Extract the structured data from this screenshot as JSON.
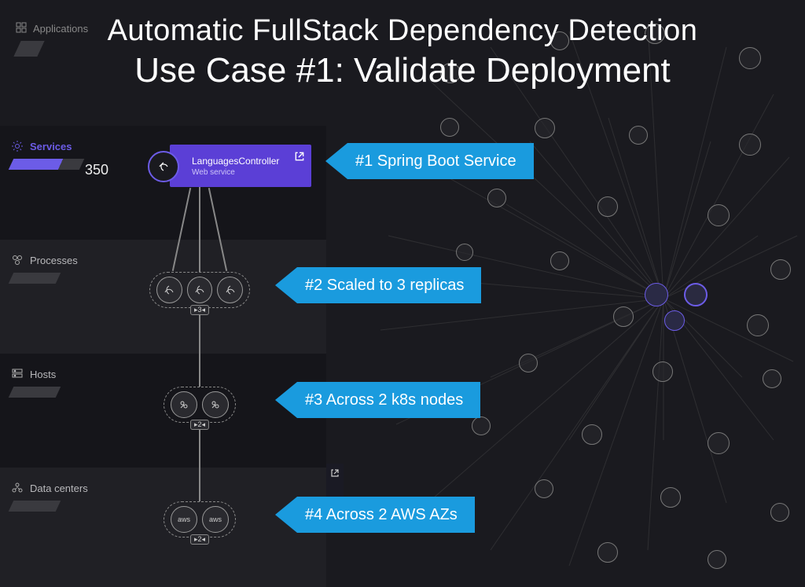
{
  "app_label": "Applications",
  "title": {
    "line1": "Automatic FullStack Dependency Detection",
    "line2": "Use Case #1: Validate Deployment"
  },
  "layers": {
    "services": {
      "label": "Services",
      "count": "350"
    },
    "processes": {
      "label": "Processes"
    },
    "hosts": {
      "label": "Hosts"
    },
    "datacenters": {
      "label": "Data centers"
    }
  },
  "service_card": {
    "name": "LanguagesController",
    "type": "Web service"
  },
  "clusters": {
    "processes": {
      "count_label": "▸3◂"
    },
    "hosts": {
      "count_label": "▸2◂"
    },
    "datacenters": {
      "count_label": "▸2◂",
      "node_label": "aws"
    }
  },
  "callouts": {
    "c1": "#1 Spring Boot Service",
    "c2": "#2 Scaled to 3 replicas",
    "c3": "#3 Across 2 k8s nodes",
    "c4": "#4 Across 2 AWS AZs"
  },
  "colors": {
    "accent_purple": "#6c5ce7",
    "callout_blue": "#1a9bde"
  }
}
